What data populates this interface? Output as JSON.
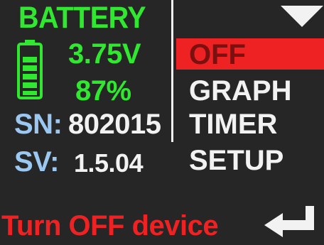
{
  "header": {
    "title": "BATTERY",
    "voltage": "3.75V",
    "percent": "87%",
    "battery_level_fraction": 0.87
  },
  "device_info": {
    "sn_label": "SN:",
    "sn_value": "802015",
    "sv_label": "SV:",
    "sv_value": "1.5.04"
  },
  "menu": {
    "items": [
      {
        "label": "OFF",
        "selected": true
      },
      {
        "label": "GRAPH",
        "selected": false
      },
      {
        "label": "TIMER",
        "selected": false
      },
      {
        "label": "SETUP",
        "selected": false
      }
    ]
  },
  "footer": {
    "status_text": "Turn OFF device"
  },
  "colors": {
    "background": "#262626",
    "green": "#2fe82f",
    "blue_label": "#9ac8f2",
    "text_white": "#f2f2f2",
    "highlight_red": "#ee2222",
    "selected_text": "#7a1010"
  },
  "icons": {
    "battery": "battery-icon",
    "scroll": "down-arrow-icon",
    "confirm": "enter-arrow-icon"
  }
}
